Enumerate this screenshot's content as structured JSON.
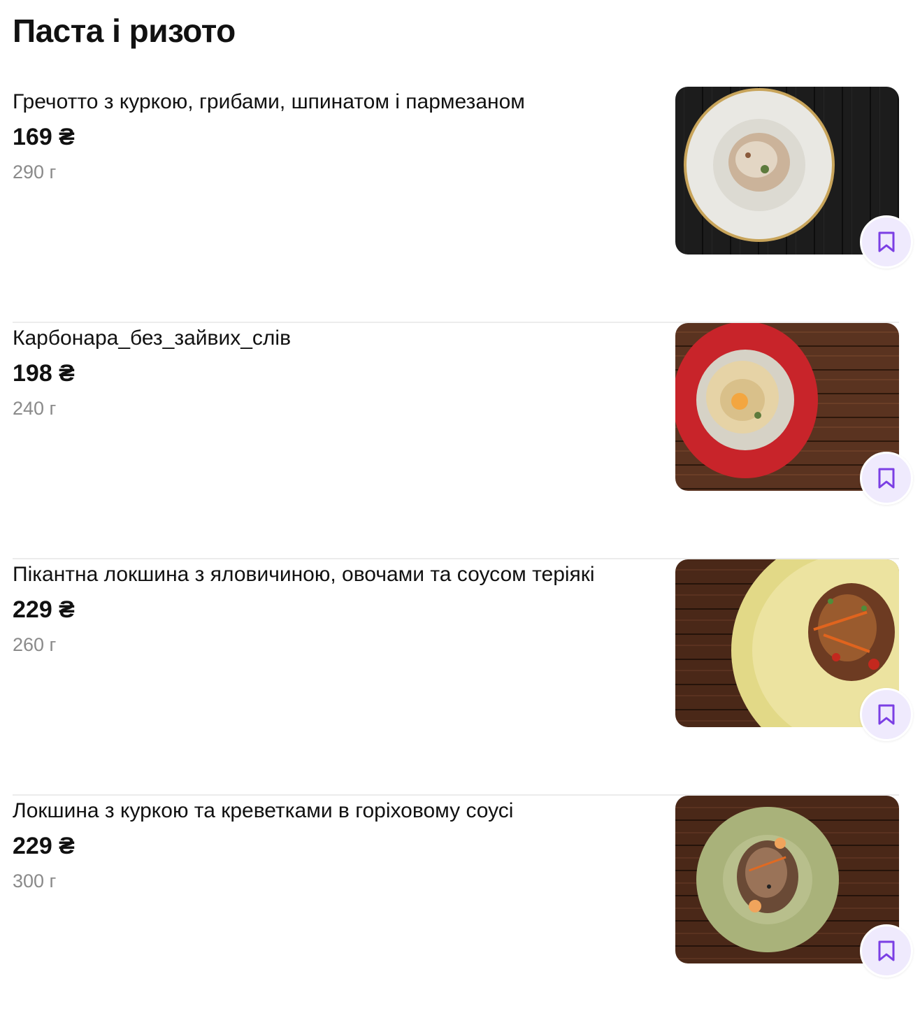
{
  "section": {
    "title": "Паста і ризото"
  },
  "colors": {
    "accent": "#7b3fe4",
    "fav_bg": "#efeafd",
    "weight_text": "#8a8a8a",
    "divider": "#ececec"
  },
  "items": [
    {
      "name": "Гречотто з куркою, грибами, шпинатом і пармезаном",
      "price": "169 ₴",
      "weight": "290 г",
      "photo_icon": "plate-photo",
      "fav_icon": "bookmark-icon"
    },
    {
      "name": "Карбонара_без_зайвих_слів",
      "price": "198 ₴",
      "weight": "240 г",
      "photo_icon": "plate-photo",
      "fav_icon": "bookmark-icon"
    },
    {
      "name": "Пікантна локшина з яловичиною, овочами та соусом теріякі",
      "price": "229 ₴",
      "weight": "260 г",
      "photo_icon": "plate-photo",
      "fav_icon": "bookmark-icon"
    },
    {
      "name": "Локшина з куркою та креветками в горіховому соусі",
      "price": "229 ₴",
      "weight": "300 г",
      "photo_icon": "plate-photo",
      "fav_icon": "bookmark-icon"
    }
  ]
}
